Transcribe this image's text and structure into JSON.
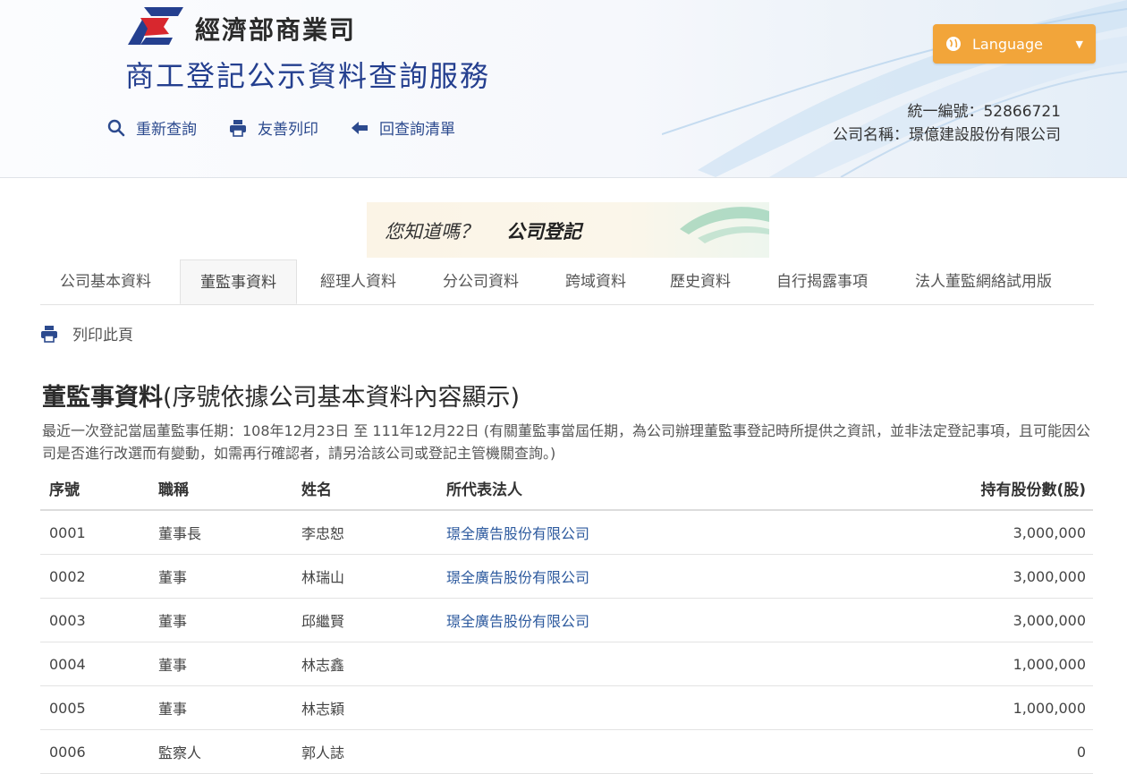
{
  "header": {
    "ministry_name": "經濟部商業司",
    "service_name": "商工登記公示資料查詢服務",
    "toolbar": [
      {
        "label": "重新查詢",
        "icon": "search-icon"
      },
      {
        "label": "友善列印",
        "icon": "printer-icon"
      },
      {
        "label": "回查詢清單",
        "icon": "arrow-left-icon"
      }
    ],
    "language_label": "Language",
    "company_id_line": "統一編號：52866721",
    "company_name_line": "公司名稱：璟億建設股份有限公司"
  },
  "banner": {
    "question": "您知道嗎？",
    "topic": "公司登記"
  },
  "tabs": [
    {
      "label": "公司基本資料",
      "active": false
    },
    {
      "label": "董監事資料",
      "active": true
    },
    {
      "label": "經理人資料",
      "active": false
    },
    {
      "label": "分公司資料",
      "active": false
    },
    {
      "label": "跨域資料",
      "active": false
    },
    {
      "label": "歷史資料",
      "active": false
    },
    {
      "label": "自行揭露事項",
      "active": false
    },
    {
      "label": "法人董監網絡試用版",
      "active": false
    }
  ],
  "print_page_label": "列印此頁",
  "section": {
    "title_main": "董監事資料",
    "title_sub": "(序號依據公司基本資料內容顯示)",
    "note": "最近一次登記當屆董監事任期：108年12月23日 至 111年12月22日 (有關董監事當屆任期，為公司辦理董監事登記時所提供之資訊，並非法定登記事項，且可能因公司是否進行改選而有變動，如需再行確認者，請另洽該公司或登記主管機關查詢。)"
  },
  "table": {
    "headers": [
      "序號",
      "職稱",
      "姓名",
      "所代表法人",
      "持有股份數(股)"
    ],
    "rows": [
      {
        "no": "0001",
        "title": "董事長",
        "name": "李忠恕",
        "rep": "璟全廣告股份有限公司",
        "shares": "3,000,000"
      },
      {
        "no": "0002",
        "title": "董事",
        "name": "林瑞山",
        "rep": "璟全廣告股份有限公司",
        "shares": "3,000,000"
      },
      {
        "no": "0003",
        "title": "董事",
        "name": "邱繼賢",
        "rep": "璟全廣告股份有限公司",
        "shares": "3,000,000"
      },
      {
        "no": "0004",
        "title": "董事",
        "name": "林志鑫",
        "rep": "",
        "shares": "1,000,000"
      },
      {
        "no": "0005",
        "title": "董事",
        "name": "林志穎",
        "rep": "",
        "shares": "1,000,000"
      },
      {
        "no": "0006",
        "title": "監察人",
        "name": "郭人誌",
        "rep": "",
        "shares": "0"
      }
    ]
  },
  "colors": {
    "brand_blue": "#243f8f",
    "brand_red": "#d8272e",
    "language_orange": "#f2a53a",
    "link_blue": "#2d5a9e"
  }
}
